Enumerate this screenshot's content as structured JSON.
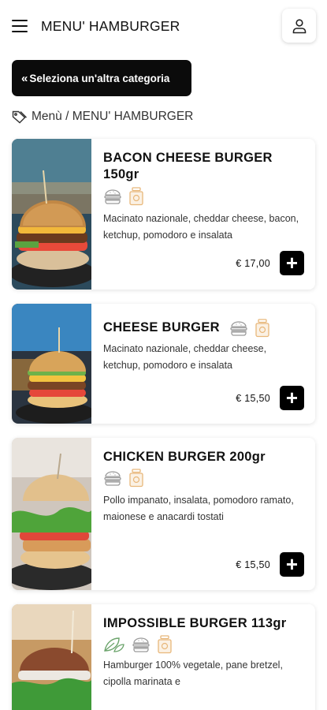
{
  "header": {
    "title": "MENU' HAMBURGER",
    "menu_icon": "hamburger-menu-icon",
    "user_icon": "user-icon"
  },
  "category_button": {
    "label": "Seleziona un'altra categoria",
    "icon": "double-chevron-left-icon"
  },
  "breadcrumb": {
    "icon": "tag-icon",
    "text": "Menù / MENU' HAMBURGER"
  },
  "colors": {
    "accent": "#000000",
    "icon_beige": "#e8b77a",
    "icon_gray": "#9a9a9a",
    "icon_green": "#6aa36a"
  },
  "products": [
    {
      "name": "BACON CHEESE BURGER 150gr",
      "icons": [
        "burger-icon",
        "glass-jar-icon"
      ],
      "description": "Macinato nazionale, cheddar cheese, bacon, ketchup, pomodoro e insalata",
      "price": "€ 17,00"
    },
    {
      "name": "CHEESE BURGER",
      "icons": [
        "burger-icon",
        "glass-jar-icon"
      ],
      "description": "Macinato nazionale, cheddar cheese, ketchup, pomodoro e insalata",
      "price": "€ 15,50"
    },
    {
      "name": "CHICKEN BURGER 200gr",
      "icons": [
        "burger-icon",
        "glass-jar-icon"
      ],
      "description": "Pollo impanato, insalata, pomodoro ramato, maionese e anacardi tostati",
      "price": "€ 15,50"
    },
    {
      "name": "IMPOSSIBLE BURGER 113gr",
      "icons": [
        "leaf-icon",
        "burger-icon",
        "glass-jar-icon"
      ],
      "description": "Hamburger 100% vegetale, pane bretzel, cipolla marinata e",
      "price": ""
    }
  ]
}
